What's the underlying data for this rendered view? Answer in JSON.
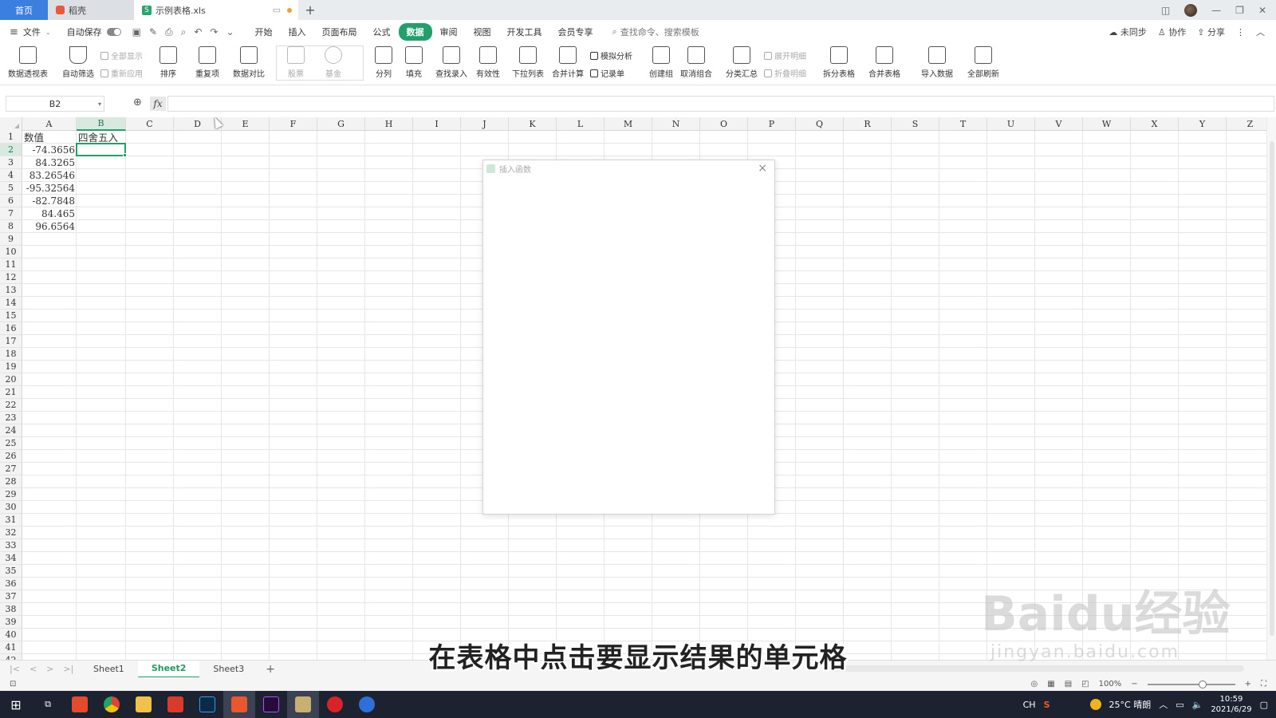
{
  "titlebar": {
    "tabs": [
      {
        "label": "首页",
        "icon": "home-icon"
      },
      {
        "label": "稻壳",
        "icon": "docer-icon"
      },
      {
        "label": "示例表格.xls",
        "icon": "spreadsheet-icon"
      }
    ],
    "add_tab": "+"
  },
  "menubar": {
    "file_label": "文件",
    "autosave_label": "自动保存",
    "tabs": [
      "开始",
      "插入",
      "页面布局",
      "公式",
      "数据",
      "审阅",
      "视图",
      "开发工具",
      "会员专享"
    ],
    "active_tab": "数据",
    "search_label": "查找命令、搜索模板",
    "right_items": [
      "未同步",
      "协作",
      "分享"
    ]
  },
  "ribbon": {
    "buttons": [
      {
        "label": "数据透视表",
        "icon": "pivot-table-icon",
        "enabled": true
      },
      {
        "label": "自动筛选",
        "icon": "filter-icon",
        "enabled": true
      },
      {
        "label": "排序",
        "icon": "sort-icon",
        "enabled": true
      },
      {
        "label": "重复项",
        "icon": "duplicates-icon",
        "enabled": true
      },
      {
        "label": "数据对比",
        "icon": "data-compare-icon",
        "enabled": true
      },
      {
        "label": "股票",
        "icon": "stock-icon",
        "enabled": false
      },
      {
        "label": "基金",
        "icon": "fund-icon",
        "enabled": false
      },
      {
        "label": "分列",
        "icon": "text-to-columns-icon",
        "enabled": true
      },
      {
        "label": "填充",
        "icon": "fill-icon",
        "enabled": true
      },
      {
        "label": "查找录入",
        "icon": "lookup-entry-icon",
        "enabled": true
      },
      {
        "label": "有效性",
        "icon": "validation-icon",
        "enabled": true
      },
      {
        "label": "下拉列表",
        "icon": "dropdown-list-icon",
        "enabled": true
      },
      {
        "label": "合并计算",
        "icon": "consolidate-icon",
        "enabled": true
      },
      {
        "label": "创建组",
        "icon": "group-icon",
        "enabled": true
      },
      {
        "label": "取消组合",
        "icon": "ungroup-icon",
        "enabled": true
      },
      {
        "label": "分类汇总",
        "icon": "subtotal-icon",
        "enabled": true
      },
      {
        "label": "拆分表格",
        "icon": "split-table-icon",
        "enabled": true
      },
      {
        "label": "合并表格",
        "icon": "merge-table-icon",
        "enabled": true
      },
      {
        "label": "导入数据",
        "icon": "import-data-icon",
        "enabled": true
      },
      {
        "label": "全部刷新",
        "icon": "refresh-all-icon",
        "enabled": true
      }
    ],
    "small_buttons": [
      {
        "label": "全部显示",
        "enabled": false
      },
      {
        "label": "重新应用",
        "enabled": false
      },
      {
        "label": "模拟分析",
        "enabled": true
      },
      {
        "label": "记录单",
        "enabled": true
      },
      {
        "label": "展开明细",
        "enabled": false
      },
      {
        "label": "折叠明细",
        "enabled": false
      }
    ]
  },
  "formula_bar": {
    "name_box": "B2",
    "fx_label": "fx",
    "formula": ""
  },
  "grid": {
    "columns": [
      "A",
      "B",
      "C",
      "D",
      "E",
      "F",
      "G",
      "H",
      "I",
      "J",
      "K",
      "L",
      "M",
      "N",
      "O",
      "P",
      "Q",
      "R",
      "S",
      "T",
      "U",
      "V",
      "W",
      "X",
      "Y",
      "Z"
    ],
    "selected_column": "B",
    "selected_row": 2,
    "row_count": 42,
    "cells": {
      "A1": "数值",
      "B1": "四舍五入",
      "A2": "-74.3656",
      "A3": "84.3265",
      "A4": "83.26546",
      "A5": "-95.32564",
      "A6": "-82.7848",
      "A7": "84.465",
      "A8": "96.6564"
    }
  },
  "dialog": {
    "title": "插入函数",
    "close": "×"
  },
  "sheets": {
    "tabs": [
      "Sheet1",
      "Sheet2",
      "Sheet3"
    ],
    "active": "Sheet2",
    "add": "+"
  },
  "statusbar": {
    "zoom": "100%"
  },
  "subtitle": "在表格中点击要显示结果的单元格",
  "watermark": {
    "main": "Baidu经验",
    "sub": "jingyan.baidu.com"
  },
  "taskbar": {
    "ime": "CH",
    "weather": "25°C 晴朗",
    "time": "10:59",
    "date": "2021/6/29"
  },
  "colors": {
    "accent": "#22a06b",
    "home_tab": "#3b7fe0",
    "taskbar": "#1c2230"
  }
}
